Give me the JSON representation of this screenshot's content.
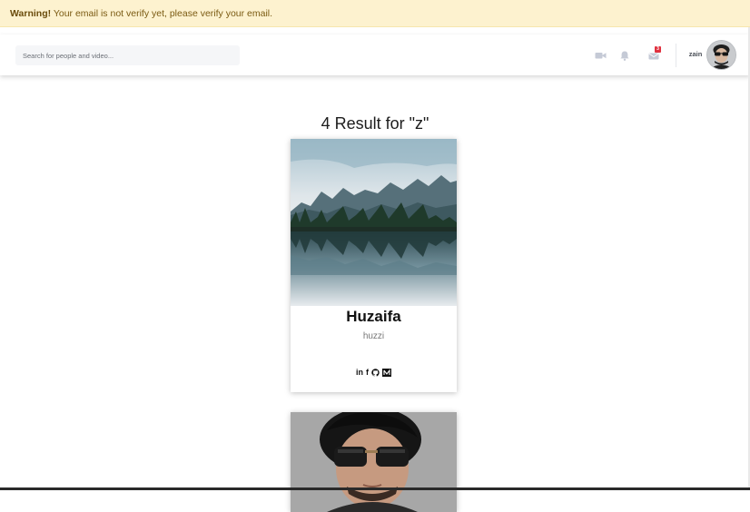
{
  "warning": {
    "label": "Warning!",
    "message": " Your email is not verify yet, please verify your email."
  },
  "navbar": {
    "search_placeholder": "Search for people and video...",
    "icons": [
      "video-camera-icon",
      "bell-icon",
      "message-icon"
    ],
    "message_badge": "3",
    "username": "zain"
  },
  "results": {
    "heading": "4 Result for \"z\"",
    "cards": [
      {
        "name": "Huzaifa",
        "username": "huzzi",
        "image": "mountain-lake-landscape",
        "socials": [
          {
            "icon": "linkedin-icon",
            "label": "in"
          },
          {
            "icon": "facebook-icon",
            "label": "f"
          },
          {
            "icon": "github-icon",
            "label": ""
          },
          {
            "icon": "medium-icon",
            "label": ""
          }
        ]
      },
      {
        "image": "person-with-sunglasses-photo"
      }
    ]
  },
  "colors": {
    "warning_bg": "#fdf2cf",
    "warning_text": "#7a5a12",
    "badge": "#e0313f",
    "nav_icon": "#c5cad6"
  }
}
